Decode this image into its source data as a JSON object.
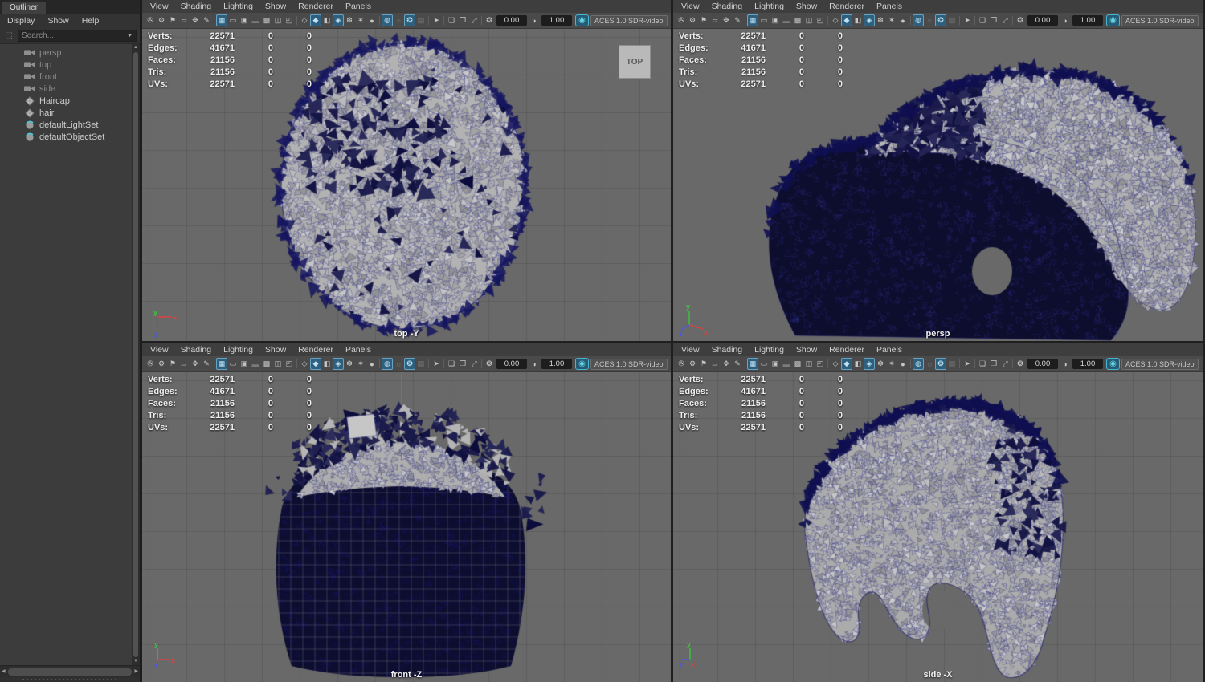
{
  "outliner": {
    "tab": "Outliner",
    "menus": [
      {
        "label": "Display"
      },
      {
        "label": "Show"
      },
      {
        "label": "Help"
      }
    ],
    "search_placeholder": "Search...",
    "items": [
      {
        "label": "persp",
        "icon": "camera-icon",
        "dim": true
      },
      {
        "label": "top",
        "icon": "camera-icon",
        "dim": true
      },
      {
        "label": "front",
        "icon": "camera-icon",
        "dim": true
      },
      {
        "label": "side",
        "icon": "camera-icon",
        "dim": true
      },
      {
        "label": "Haircap",
        "icon": "mesh-icon",
        "dim": false
      },
      {
        "label": "hair",
        "icon": "mesh-icon",
        "dim": false
      },
      {
        "label": "defaultLightSet",
        "icon": "set-icon",
        "dim": false
      },
      {
        "label": "defaultObjectSet",
        "icon": "set-icon",
        "dim": false
      }
    ]
  },
  "viewport_chrome": {
    "menus": [
      {
        "label": "View"
      },
      {
        "label": "Shading"
      },
      {
        "label": "Lighting"
      },
      {
        "label": "Show"
      },
      {
        "label": "Renderer"
      },
      {
        "label": "Panels"
      }
    ],
    "toolbar": [
      {
        "name": "select-camera-icon",
        "glyph": "✇"
      },
      {
        "name": "camera-attributes-icon",
        "glyph": "⚙"
      },
      {
        "name": "camera-bookmark-icon",
        "glyph": "⚑"
      },
      {
        "name": "image-plane-icon",
        "glyph": "▱"
      },
      {
        "name": "pan-zoom-2d-icon",
        "glyph": "✥"
      },
      {
        "name": "grease-pencil-icon",
        "glyph": "✎"
      },
      {
        "sep": true
      },
      {
        "name": "grid-icon",
        "glyph": "▦",
        "state": "active"
      },
      {
        "name": "film-gate-icon",
        "glyph": "▭"
      },
      {
        "name": "resolution-gate-icon",
        "glyph": "▣"
      },
      {
        "name": "gate-mask-icon",
        "glyph": "▬",
        "state": "dim"
      },
      {
        "name": "field-chart-icon",
        "glyph": "▩"
      },
      {
        "name": "safe-action-icon",
        "glyph": "◫"
      },
      {
        "name": "safe-title-icon",
        "glyph": "◰"
      },
      {
        "sep": true
      },
      {
        "name": "wireframe-icon",
        "glyph": "◇"
      },
      {
        "name": "shaded-icon",
        "glyph": "◆",
        "state": "active"
      },
      {
        "name": "textured-icon",
        "glyph": "◧"
      },
      {
        "name": "wireframe-on-shaded-icon",
        "glyph": "◈",
        "state": "active"
      },
      {
        "name": "default-material-icon",
        "glyph": "❆"
      },
      {
        "name": "lighting-icon",
        "glyph": "✶"
      },
      {
        "name": "shadows-icon",
        "glyph": "●"
      },
      {
        "sep": true
      },
      {
        "name": "occlusion-icon",
        "glyph": "◍",
        "state": "active"
      },
      {
        "name": "motion-blur-icon",
        "glyph": "◌"
      },
      {
        "name": "anti-aliasing-icon",
        "glyph": "❂",
        "state": "active"
      },
      {
        "name": "depth-peeling-icon",
        "glyph": "▤",
        "state": "dim"
      },
      {
        "sep": true
      },
      {
        "name": "isolate-select-icon",
        "glyph": "➤"
      },
      {
        "sep": true
      },
      {
        "name": "snapshot-icon",
        "glyph": "❏"
      },
      {
        "name": "scene-view-icon",
        "glyph": "❐"
      },
      {
        "name": "frame-all-icon",
        "glyph": "⤢"
      }
    ],
    "exposure": {
      "value": "0.00",
      "icon_glyph": "❂"
    },
    "gamma": {
      "value": "1.00",
      "icon_glyph": "◑"
    },
    "color_management": {
      "toggle_glyph": "◉",
      "label": "ACES 1.0 SDR-video"
    }
  },
  "heads_up": {
    "rows": [
      {
        "label": "Verts:",
        "value": "22571",
        "col1": "0",
        "col2": "0"
      },
      {
        "label": "Edges:",
        "value": "41671",
        "col1": "0",
        "col2": "0"
      },
      {
        "label": "Faces:",
        "value": "21156",
        "col1": "0",
        "col2": "0"
      },
      {
        "label": "Tris:",
        "value": "21156",
        "col1": "0",
        "col2": "0"
      },
      {
        "label": "UVs:",
        "value": "22571",
        "col1": "0",
        "col2": "0"
      }
    ]
  },
  "viewports": [
    {
      "id": "top",
      "label": "top -Y",
      "tag": "TOP"
    },
    {
      "id": "persp",
      "label": "persp"
    },
    {
      "id": "front",
      "label": "front -Z"
    },
    {
      "id": "side",
      "label": "side -X"
    }
  ],
  "axis_gizmo": {
    "x": "x",
    "y": "y",
    "z": "z"
  },
  "colors": {
    "accent": "#49b6cf",
    "active_icon_bg": "#2e5f7d",
    "viewport_bg": "#696969",
    "wire_navy": "#1a1a7e",
    "mesh_gray": "#b2b2b2",
    "dark_mesh": "#0d0d30"
  }
}
